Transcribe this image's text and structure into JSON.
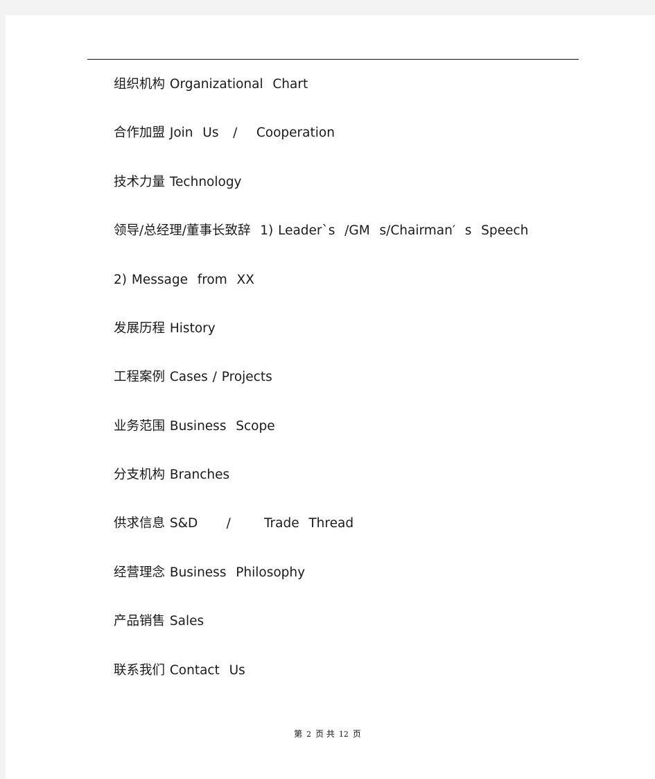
{
  "document": {
    "lines": [
      "组织机构 Organizational  Chart",
      "合作加盟 Join  Us   /    Cooperation",
      "技术力量 Technology",
      "领导/总经理/董事长致辞  1) Leader`s  /GM  s/Chairman′  s  Speech",
      "2) Message  from  XX",
      "发展历程 History",
      "工程案例 Cases / Projects",
      "业务范围 Business  Scope",
      "分支机构 Branches",
      "供求信息 S&D      /       Trade  Thread",
      "经营理念 Business  Philosophy",
      "产品销售 Sales",
      "联系我们 Contact  Us"
    ]
  },
  "footer": {
    "prefix": "第",
    "current_page": "2",
    "middle": "页 共",
    "total_pages": "12",
    "suffix": "页"
  }
}
